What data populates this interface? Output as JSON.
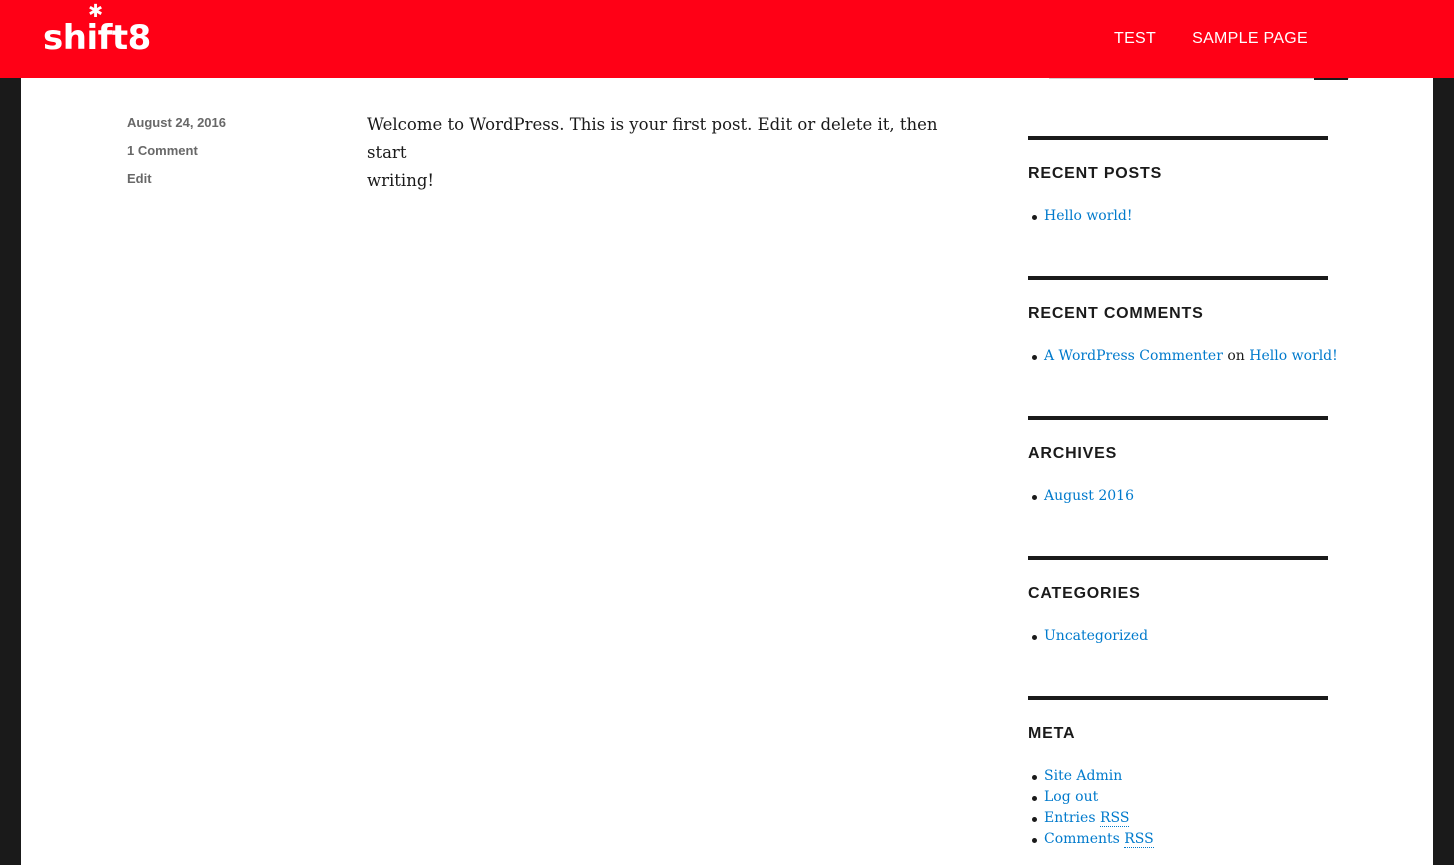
{
  "site": {
    "logo_text": "shift8",
    "brand_color": "#ff0016"
  },
  "nav": {
    "items": [
      {
        "label": "TEST"
      },
      {
        "label": "SAMPLE PAGE"
      }
    ]
  },
  "post": {
    "date": "August 24, 2016",
    "comments": "1 Comment",
    "edit": "Edit",
    "body_line1": "Welcome to WordPress. This is your first post. Edit or delete it, then start",
    "body_line2": "writing!"
  },
  "sidebar": {
    "recent_posts": {
      "title": "RECENT POSTS",
      "items": [
        "Hello world!"
      ]
    },
    "recent_comments": {
      "title": "RECENT COMMENTS",
      "author": "A WordPress Commenter",
      "on": "on",
      "post": "Hello world!"
    },
    "archives": {
      "title": "ARCHIVES",
      "items": [
        "August 2016"
      ]
    },
    "categories": {
      "title": "CATEGORIES",
      "items": [
        "Uncategorized"
      ]
    },
    "meta": {
      "title": "META",
      "site_admin": "Site Admin",
      "log_out": "Log out",
      "entries": "Entries",
      "comments": "Comments",
      "rss": "RSS"
    }
  },
  "colors": {
    "link": "#007acc",
    "text": "#1a1a1a",
    "meta": "#686868"
  }
}
